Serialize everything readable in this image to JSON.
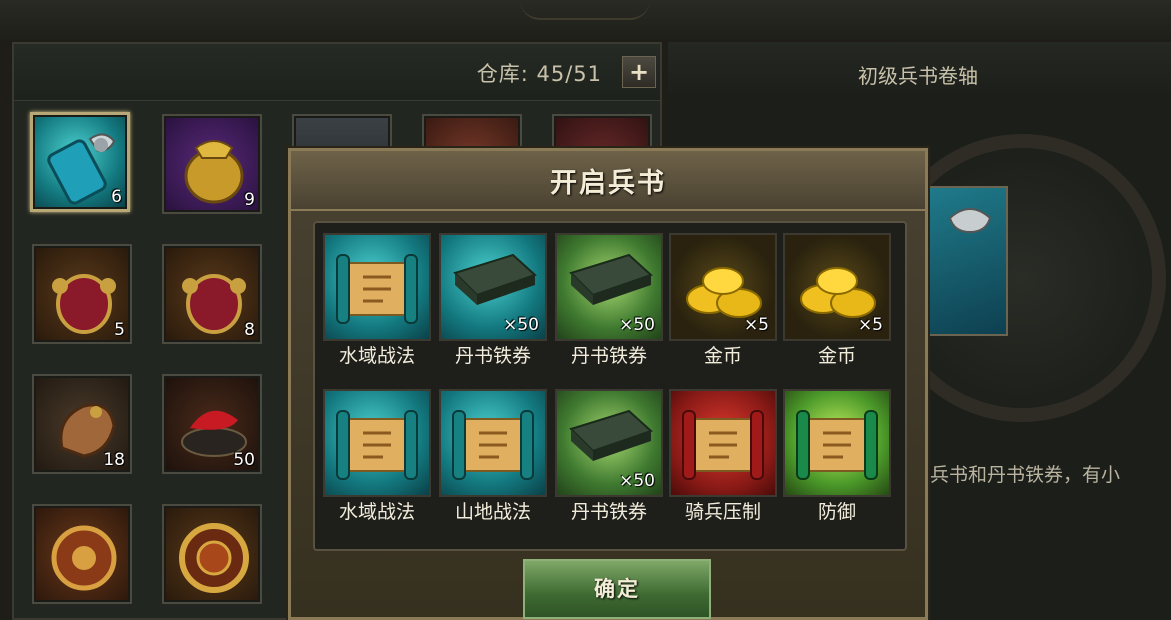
{
  "inventory": {
    "capacity_label": "仓库: 45/51",
    "add_button": "+",
    "slots": [
      {
        "icon": "scroll-item-icon",
        "count": "6",
        "selected": true
      },
      {
        "icon": "gold-pouch-icon",
        "count": "9"
      },
      {
        "icon": "item-icon",
        "count": ""
      },
      {
        "icon": "item-icon",
        "count": ""
      },
      {
        "icon": "item-icon",
        "count": ""
      },
      {
        "icon": "red-pouch-icon",
        "count": "5"
      },
      {
        "icon": "red-pouch-icon",
        "count": "8"
      },
      {
        "icon": "bronze-item-icon",
        "count": "18"
      },
      {
        "icon": "red-cloth-icon",
        "count": "50"
      },
      {
        "icon": "ornament-icon",
        "count": ""
      },
      {
        "icon": "ornament-icon",
        "count": ""
      }
    ]
  },
  "detail": {
    "title": "初级兵书卷轴",
    "description": "兵书和丹书铁券，有小"
  },
  "modal": {
    "title": "开启兵书",
    "confirm_label": "确定",
    "rewards": [
      {
        "name": "水域战法",
        "qty": "",
        "icon": "teal-scroll-icon"
      },
      {
        "name": "丹书铁券",
        "qty": "×50",
        "icon": "iron-tablet-icon"
      },
      {
        "name": "丹书铁券",
        "qty": "×50",
        "icon": "iron-tablet-icon"
      },
      {
        "name": "金币",
        "qty": "×5",
        "icon": "gold-ingot-icon"
      },
      {
        "name": "金币",
        "qty": "×5",
        "icon": "gold-ingot-icon"
      },
      {
        "name": "水域战法",
        "qty": "",
        "icon": "teal-scroll-icon"
      },
      {
        "name": "山地战法",
        "qty": "",
        "icon": "teal-scroll-icon"
      },
      {
        "name": "丹书铁券",
        "qty": "×50",
        "icon": "iron-tablet-icon"
      },
      {
        "name": "骑兵压制",
        "qty": "",
        "icon": "red-scroll-icon"
      },
      {
        "name": "防御",
        "qty": "",
        "icon": "green-scroll-icon"
      }
    ]
  },
  "colors": {
    "gold_text": "#c9c2aa",
    "modal_border": "#8a7a56",
    "confirm_green": "#3e6a32"
  }
}
